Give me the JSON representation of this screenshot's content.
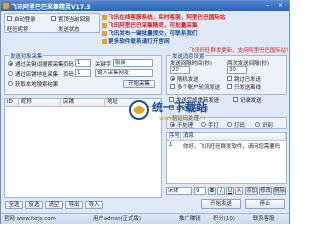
{
  "window": {
    "title": "飞讯阿里巴巴采集精灵V17.3"
  },
  "top_options": {
    "auto_login": "自动登录",
    "hide_replied": "置顶当前回复",
    "reply_count": "旺旺昵称",
    "send_status": "发送状态"
  },
  "ads": [
    "飞讯在线客服系统，实时客服，阿里巴巴国际站",
    "飞讯阿里巴巴采集精灵，可批量采集",
    "飞讯发布一键批量提交，可联系我们",
    "更多软件联系请打开官网"
  ],
  "marquee": "飞讯旺旺群发更新，支持阿里巴巴国际站！",
  "collect_group": {
    "title": "发送对象采集",
    "radio_keyword": "通过关键词搜索采集",
    "page_label": "页码",
    "page_value": "1",
    "keyword_label": "关键字",
    "keyword_value": "服装",
    "radio_shop": "通过店铺地址采集",
    "page2_label": "页码",
    "page2_value": "1",
    "url_value": "输入采集网址",
    "radio_import": "获取本地搜索结果",
    "start_btn": "开始采集"
  },
  "table": {
    "columns": [
      "ID",
      "昵称",
      "店铺",
      "地址"
    ]
  },
  "send_group": {
    "title": "发送消息设置",
    "tabs": [
      "发送间隔时间(秒)",
      "两次发送间隔(秒)"
    ],
    "interval_value": "20",
    "interval2_value": "30",
    "option_random": "随机发送",
    "option_skip": "跳过已发送",
    "option_multi": "多个账户轮流发送",
    "option_sent": "只发送离线",
    "option_repeat": "发送完成重新发送",
    "option_log": "记录发送",
    "option_save": "自动保存日志"
  },
  "verify_group": {
    "title": "验证码处理",
    "opt_none": "不处理",
    "opt_manual": "手打",
    "opt_auto": "打码",
    "opt_skip": "识别"
  },
  "message": {
    "col_index": "序号",
    "col_msg": "消息",
    "row_index": "1",
    "row_msg": "你好，飞讯旺旺群发软件，请问您需要吗"
  },
  "bottom_controls": {
    "font_select": "宋体",
    "size_select": "9",
    "bold": "B",
    "italic": "I",
    "underline": "U",
    "color": "A",
    "add_btn": "添加",
    "edit_btn": "修改",
    "delete_btn": "删除"
  },
  "action_buttons": {
    "select_all": "全选",
    "invert": "反选",
    "clear": "清空",
    "export": "导出",
    "import": "导入",
    "start_send": "开始发送",
    "stop_send": "停止"
  },
  "status_bar": {
    "website": "官网 www.fxrjs.com",
    "user": "用户admin(正式版)",
    "promo": "推广赚钱",
    "points": "积分(10)",
    "contact": "联系客服"
  },
  "watermark": {
    "brand": "统一下载站",
    "domain": "www.3987.com",
    "tagline": "统一下载站"
  },
  "colors": {
    "title_bar": "#2a62b8",
    "ad_red": "#e02020",
    "ad_blue": "#1a4e9e",
    "accent_orange": "#e8a317"
  }
}
